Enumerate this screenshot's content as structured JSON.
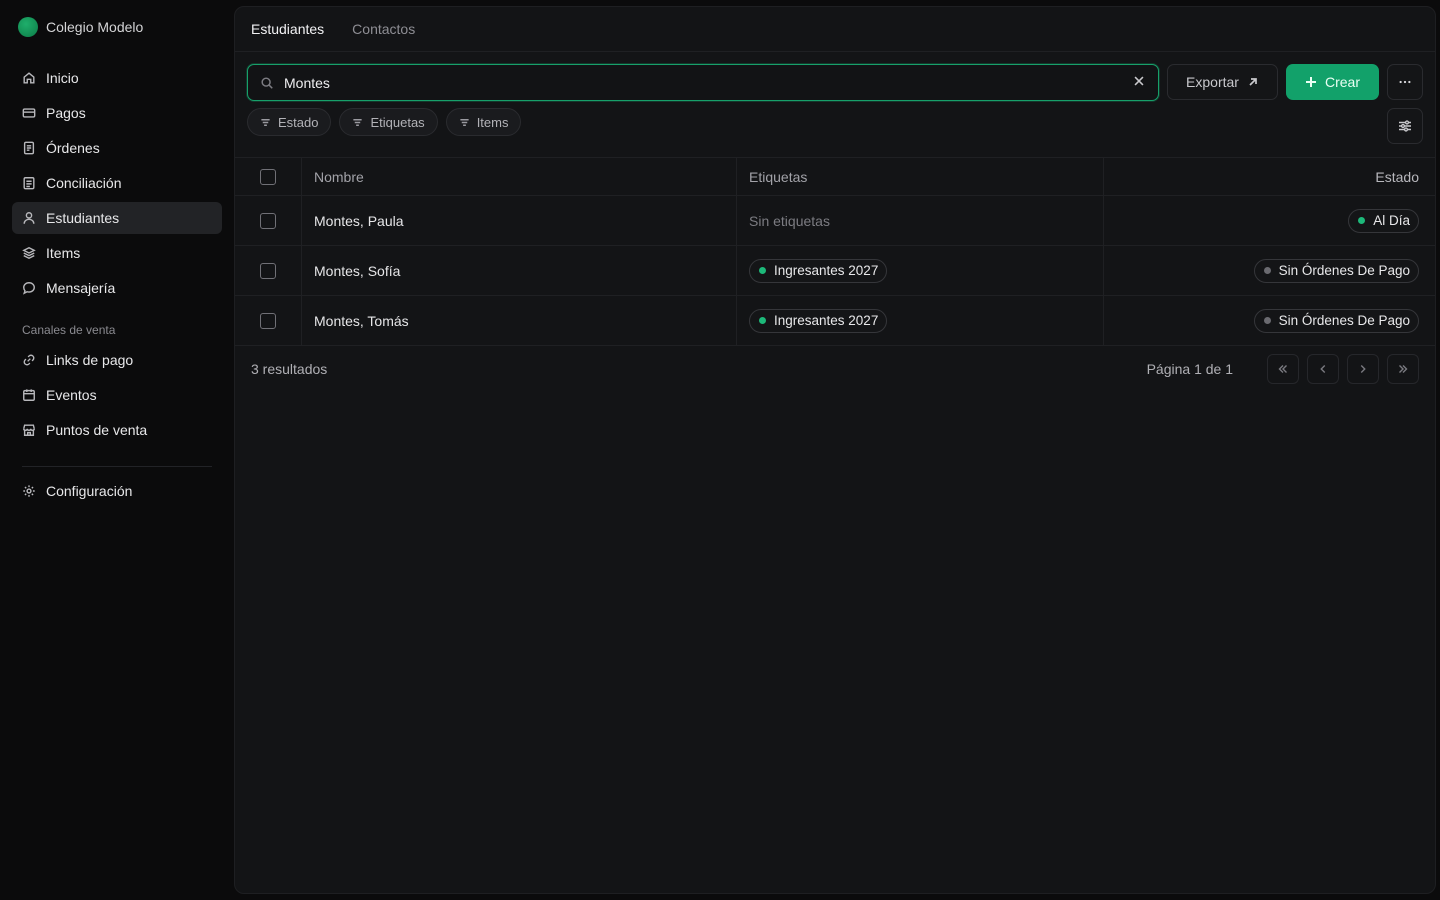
{
  "brand": {
    "name": "Colegio Modelo",
    "color": "#12a16a"
  },
  "sidebar": {
    "items": [
      {
        "label": "Inicio",
        "icon": "home-icon"
      },
      {
        "label": "Pagos",
        "icon": "credit-card-icon"
      },
      {
        "label": "Órdenes",
        "icon": "receipt-icon"
      },
      {
        "label": "Conciliación",
        "icon": "clipboard-icon"
      },
      {
        "label": "Estudiantes",
        "icon": "user-icon",
        "active": true
      },
      {
        "label": "Items",
        "icon": "layers-icon"
      },
      {
        "label": "Mensajería",
        "icon": "message-icon"
      }
    ],
    "section_label": "Canales de venta",
    "channels": [
      {
        "label": "Links de pago",
        "icon": "link-icon"
      },
      {
        "label": "Eventos",
        "icon": "calendar-icon"
      },
      {
        "label": "Puntos de venta",
        "icon": "store-icon"
      }
    ],
    "settings": {
      "label": "Configuración",
      "icon": "gear-icon"
    }
  },
  "tabs": [
    {
      "label": "Estudiantes",
      "active": true
    },
    {
      "label": "Contactos",
      "active": false
    }
  ],
  "toolbar": {
    "search_value": "Montes",
    "export_label": "Exportar",
    "create_label": "Crear"
  },
  "filters": [
    "Estado",
    "Etiquetas",
    "Items"
  ],
  "table": {
    "columns": {
      "name": "Nombre",
      "tags": "Etiquetas",
      "state": "Estado"
    },
    "rows": [
      {
        "name": "Montes, Paula",
        "tag": "Sin etiquetas",
        "tag_empty": true,
        "state": "Al Día",
        "state_color": "#1db97a"
      },
      {
        "name": "Montes, Sofía",
        "tag": "Ingresantes 2027",
        "tag_empty": false,
        "tag_color": "#1db97a",
        "state": "Sin Órdenes De Pago",
        "state_color": "#6a6a70"
      },
      {
        "name": "Montes, Tomás",
        "tag": "Ingresantes 2027",
        "tag_empty": false,
        "tag_color": "#1db97a",
        "state": "Sin Órdenes De Pago",
        "state_color": "#6a6a70"
      }
    ]
  },
  "footer": {
    "results": "3 resultados",
    "page_info": "Página 1 de 1"
  }
}
